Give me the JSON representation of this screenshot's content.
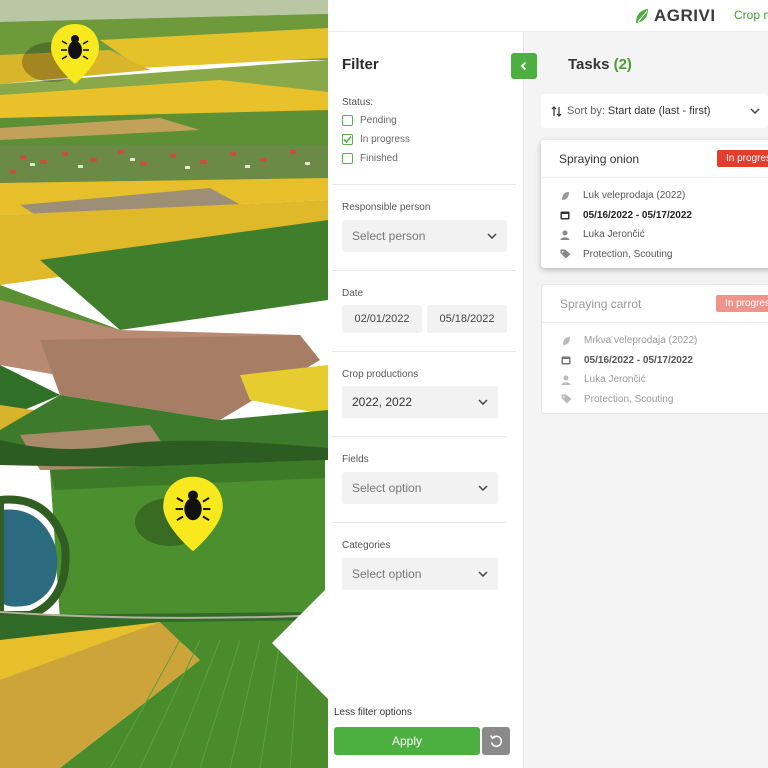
{
  "header": {
    "logo_text": "AGRIVI",
    "crop_link": "Crop m"
  },
  "filter": {
    "title": "Filter",
    "status_label": "Status:",
    "statuses": [
      {
        "label": "Pending",
        "checked": false
      },
      {
        "label": "In progress",
        "checked": true
      },
      {
        "label": "Finished",
        "checked": false
      }
    ],
    "responsible_label": "Responsible person",
    "responsible_placeholder": "Select person",
    "date_label": "Date",
    "date_from": "02/01/2022",
    "date_to": "05/18/2022",
    "crop_label": "Crop productions",
    "crop_value": "2022, 2022",
    "fields_label": "Fields",
    "fields_placeholder": "Select option",
    "categories_label": "Categories",
    "categories_placeholder": "Select option",
    "less_options": "Less filter options",
    "apply_label": "Apply"
  },
  "tasks": {
    "title": "Tasks",
    "count": "(2)",
    "sort_label": "Sort by:",
    "sort_value": "Start date (last - first)",
    "items": [
      {
        "name": "Spraying onion",
        "status": "In progress",
        "production": "Luk veleprodaja (2022)",
        "dates": "05/16/2022 - 05/17/2022",
        "person": "Luka Jerončić",
        "categories": "Protection, Scouting"
      },
      {
        "name": "Spraying carrot",
        "status": "In progress",
        "production": "Mrkva veleprodaja (2022)",
        "dates": "05/16/2022 - 05/17/2022",
        "person": "Luka Jerončić",
        "categories": "Protection, Scouting"
      }
    ]
  },
  "icons": {
    "pin": "bug-location-pin-icon",
    "logo": "leaf-logo-icon",
    "collapse": "chevron-left-icon",
    "sort": "sort-arrows-icon",
    "dropdown": "chevron-down-icon",
    "reset": "reset-icon",
    "production": "leaf-icon",
    "calendar": "calendar-icon",
    "person": "person-icon",
    "tag": "tag-icon"
  },
  "colors": {
    "brand_green": "#4caf3f",
    "status_badge_active": "#e53d2c",
    "status_badge_dim": "#f0938a",
    "pin_yellow": "#f7e91d"
  }
}
